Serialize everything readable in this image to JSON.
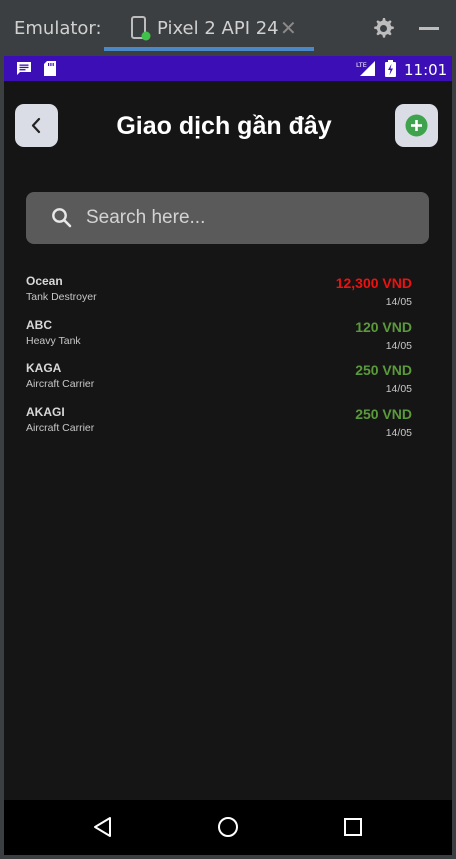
{
  "emulator": {
    "label": "Emulator:",
    "tab_label": "Pixel 2 API 24",
    "tab_close": "✕"
  },
  "status_bar": {
    "time": "11:01",
    "network": "LTE"
  },
  "header": {
    "title": "Giao dịch gần đây"
  },
  "search": {
    "placeholder": "Search here..."
  },
  "transactions": [
    {
      "name": "Ocean",
      "type": "Tank Destroyer",
      "amount": "12,300 VND",
      "date": "14/05",
      "amount_color": "#ee1111"
    },
    {
      "name": "ABC",
      "type": "Heavy Tank",
      "amount": "120 VND",
      "date": "14/05",
      "amount_color": "#5b9a3c"
    },
    {
      "name": "KAGA",
      "type": "Aircraft Carrier",
      "amount": "250 VND",
      "date": "14/05",
      "amount_color": "#5b9a3c"
    },
    {
      "name": "AKAGI",
      "type": "Aircraft Carrier",
      "amount": "250 VND",
      "date": "14/05",
      "amount_color": "#5b9a3c"
    }
  ],
  "colors": {
    "status_bar": "#3b0fb5",
    "add_icon": "#3fa34d",
    "negative_amount": "#ee1111",
    "positive_amount": "#5b9a3c"
  }
}
